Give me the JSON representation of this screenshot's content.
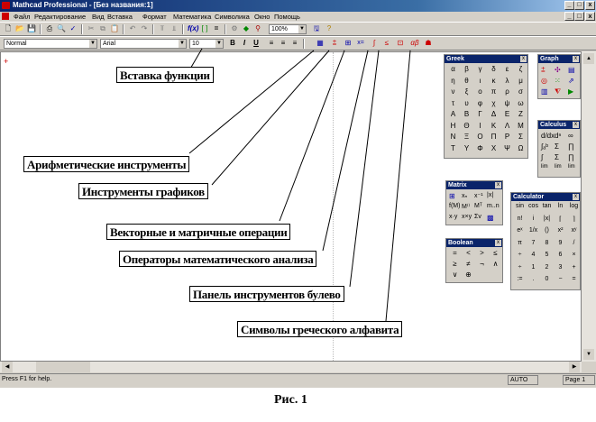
{
  "window": {
    "title": "Mathcad Professional - [Без названия:1]",
    "min": "_",
    "max": "□",
    "close": "x"
  },
  "menu": [
    "Файл",
    "Редактирование",
    "Вид",
    "Вставка",
    "Формат",
    "Математика",
    "Символика",
    "Окно",
    "Помощь"
  ],
  "format_bar": {
    "style": "Normal",
    "font": "Arial",
    "size": "10"
  },
  "zoom": "100%",
  "status": {
    "help": "Press F1 for help.",
    "mode": "AUTO",
    "page": "Page 1"
  },
  "panels": {
    "greek": {
      "title": "Greek",
      "lower": [
        "α",
        "β",
        "γ",
        "δ",
        "ε",
        "ζ",
        "η",
        "θ",
        "ι",
        "κ",
        "λ",
        "μ",
        "ν",
        "ξ",
        "ο",
        "π",
        "ρ",
        "σ",
        "τ",
        "υ",
        "φ",
        "χ",
        "ψ",
        "ω"
      ],
      "upper": [
        "Α",
        "Β",
        "Γ",
        "Δ",
        "Ε",
        "Ζ",
        "Η",
        "Θ",
        "Ι",
        "Κ",
        "Λ",
        "Μ",
        "Ν",
        "Ξ",
        "Ο",
        "Π",
        "Ρ",
        "Σ",
        "Τ",
        "Υ",
        "Φ",
        "Χ",
        "Ψ",
        "Ω"
      ]
    },
    "graph": {
      "title": "Graph"
    },
    "calculus": {
      "title": "Calculus"
    },
    "matrix": {
      "title": "Matrix"
    },
    "boolean": {
      "title": "Boolean",
      "symbols": [
        "=",
        "<",
        ">",
        "≤",
        "≥",
        "≠",
        "¬",
        "∧",
        "∨",
        "⊕"
      ]
    },
    "calculator": {
      "title": "Calculator",
      "rows": [
        [
          "sin",
          "cos",
          "tan",
          "ln",
          "log"
        ],
        [
          "n!",
          "i",
          "|x|",
          "⌈",
          "⌉"
        ],
        [
          "eˣ",
          "1/x",
          "()",
          "x²",
          "xʸ"
        ],
        [
          "π",
          "7",
          "8",
          "9",
          "/"
        ],
        [
          "÷",
          "4",
          "5",
          "6",
          "×"
        ],
        [
          "÷",
          "1",
          "2",
          "3",
          "+"
        ],
        [
          ":=",
          ".",
          "0",
          "−",
          "="
        ]
      ]
    }
  },
  "callouts": {
    "insert_function": "Вставка функции",
    "arithmetic": "Арифметические инструменты",
    "graphs": "Инструменты графиков",
    "vector_matrix": "Векторные и матричные операции",
    "calculus_ops": "Операторы математического анализа",
    "boolean_panel": "Панель инструментов булево",
    "greek_symbols": "Символы греческого алфавита"
  },
  "caption": "Рис. 1",
  "accent": "#0a246a"
}
